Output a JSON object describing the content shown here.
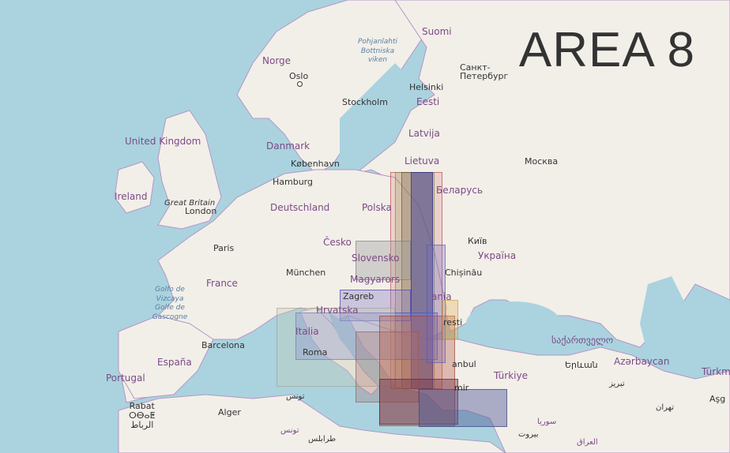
{
  "title": "AREA 8",
  "colors": {
    "sea": "#aad3df",
    "land": "#f2efe9",
    "border": "#b596c4"
  },
  "labels": {
    "suomi": "Suomi",
    "norge": "Norge",
    "oslo": "Oslo",
    "stockholm": "Stockholm",
    "helsinki": "Helsinki",
    "spb": "Санкт-Петербург",
    "eesti": "Eesti",
    "latvija": "Latvija",
    "lietuva": "Lietuva",
    "moskva": "Москва",
    "belarus": "Беларусь",
    "danmark": "Danmark",
    "kobenhavn": "København",
    "uk": "United Kingdom",
    "ireland": "Ireland",
    "great_britain": "Great Britain",
    "london": "London",
    "hamburg": "Hamburg",
    "deutschland": "Deutschland",
    "polska": "Polska",
    "cesko": "Česko",
    "kyiv": "Київ",
    "ukraina": "Україна",
    "paris": "Paris",
    "slovensko": "Slovensko",
    "france": "France",
    "munchen": "München",
    "magyarorszag": "Magyarors",
    "chisinau": "Chișinău",
    "zagreb": "Zagreb",
    "hrvatska": "Hrvatska",
    "italia": "Italia",
    "roma": "Roma",
    "barcelona": "Barcelona",
    "espana": "España",
    "portugal": "Portugal",
    "rabat": "Rabat",
    "rabat_tif": "ⵔⴱⴰⵟ",
    "rabat_ar": "الرباط",
    "alger": "Alger",
    "tunis": "تونس",
    "tunis2": "تونس",
    "tarabulus": "طرابلس",
    "sakartvelo": "საქართველო",
    "yerevan": "Երևան",
    "azerbaycan": "Azərbaycan",
    "tabriz": "تبریز",
    "turkiye": "Türkiye",
    "istanbul": "İstanbul",
    "izmir": "İzmir",
    "resti": "resti",
    "bucuresti_frag": "ania",
    "beirut": "بيروت",
    "syria": "سوريا",
    "iraq": "العراق",
    "tehran": "تهران",
    "ashgabat": "Aşg",
    "turkm": "Türkm",
    "golfo": "Golfo de Vizcaya Golfe de Gascogne",
    "bothnia": "Pohjanlahti Bottniska viken"
  }
}
